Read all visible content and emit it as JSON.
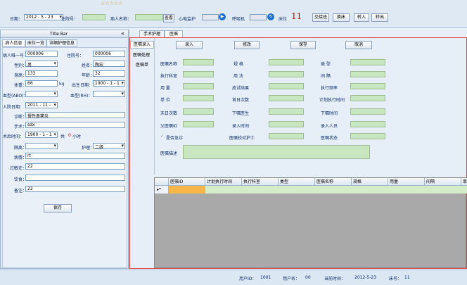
{
  "stars": "☆☆☆☆☆",
  "top": {
    "date_label": "日期：",
    "date_value": "2012 - 5 - 23",
    "inpatient_no_label": "住院号：",
    "patient_name_label": "病人名称：",
    "view_button": "查看",
    "ecg_label": "心电监护",
    "ventilator_label": "呼吸机",
    "bed_label": "床位",
    "bed_no": "11",
    "buttons": [
      "交接班",
      "换床",
      "转入",
      "转出"
    ]
  },
  "left": {
    "title": "Title Bar",
    "collapse": "«",
    "tabs": [
      "病人信息",
      "床位一览",
      "详细护理信息"
    ],
    "fields": {
      "unique_no_label": "病人唯一号",
      "unique_no": "000006",
      "inpatient_no_label": "住院号：",
      "inpatient_no": "000006",
      "gender_label": "性别：",
      "gender": "男",
      "name_label": "姓名：",
      "name": "陶宏",
      "height_label": "身高：",
      "height": "133",
      "age_label": "年龄：",
      "age": "32",
      "weight_label": "体重：",
      "weight": "66",
      "weight_unit": "kg",
      "birth_label": "出生日期：",
      "birth": "1900 - 1 - 1",
      "blood_type_label": "血型(ABO)：",
      "blood_rh_label": "血型(RH)：",
      "admit_label": "入院日期：",
      "admit": "2011 - 11 -",
      "diagnosis_label": "诊断：",
      "diagnosis": "慢性鼻窦炎",
      "surgery_label": "手术：",
      "surgery": "sdx",
      "postop_label": "术后时间：",
      "postop": "1900 - 1 - 1",
      "postop_total": "共",
      "postop_hours": "0",
      "postop_hours_unit": "小时",
      "isolation_label": "隔离：",
      "care_label": "护理：",
      "care": "二级",
      "history_label": "病情：",
      "history": "rt",
      "allergy_label": "过敏史：",
      "allergy": "22",
      "diet_label": "饮食：",
      "diet": "",
      "remark_label": "备注：",
      "remark": "22"
    },
    "save_button": "保存"
  },
  "right": {
    "tabs": [
      "手术护理",
      "医嘱"
    ],
    "side_menu": [
      "医嘱录入",
      "医嘱处理",
      "医嘱单"
    ],
    "buttons": [
      "录入",
      "修改",
      "保存",
      "取消"
    ],
    "fields": {
      "order_name": "医嘱名称",
      "spec": "规 格",
      "type": "类 型",
      "exec_dept": "执行科室",
      "usage": "用 法",
      "interval": "间 隔",
      "dosage": "用 量",
      "skin_test": "皮试结果",
      "exec_freq": "执行频率",
      "unit": "单 位",
      "first_day_count": "首日次数",
      "plan_time": "计划执行时间",
      "last_day_count": "末日次数",
      "order_doctor": "下嘱医生",
      "order_time": "下嘱时间",
      "parent_id": "父医嘱ID",
      "entry_time": "录入时间",
      "entry_user": "录入人员",
      "urgent": "是否急诊",
      "check_nurse": "医嘱校对护士",
      "status": "医嘱状态",
      "desc": "医嘱描述"
    },
    "grid_headers": [
      "医嘱ID",
      "计划执行时间",
      "执行科室",
      "类型",
      "医嘱名称",
      "规格",
      "用量",
      "间隔",
      "单"
    ],
    "row_marker": "▸*"
  },
  "status": {
    "user_id_label": "用户ID：",
    "user_id": "1001",
    "user_name_label": "用户名：",
    "user_name": "00",
    "time_label": "当前时间：",
    "time": "2012-5-23",
    "bed_label": "床号：",
    "bed": "11"
  }
}
